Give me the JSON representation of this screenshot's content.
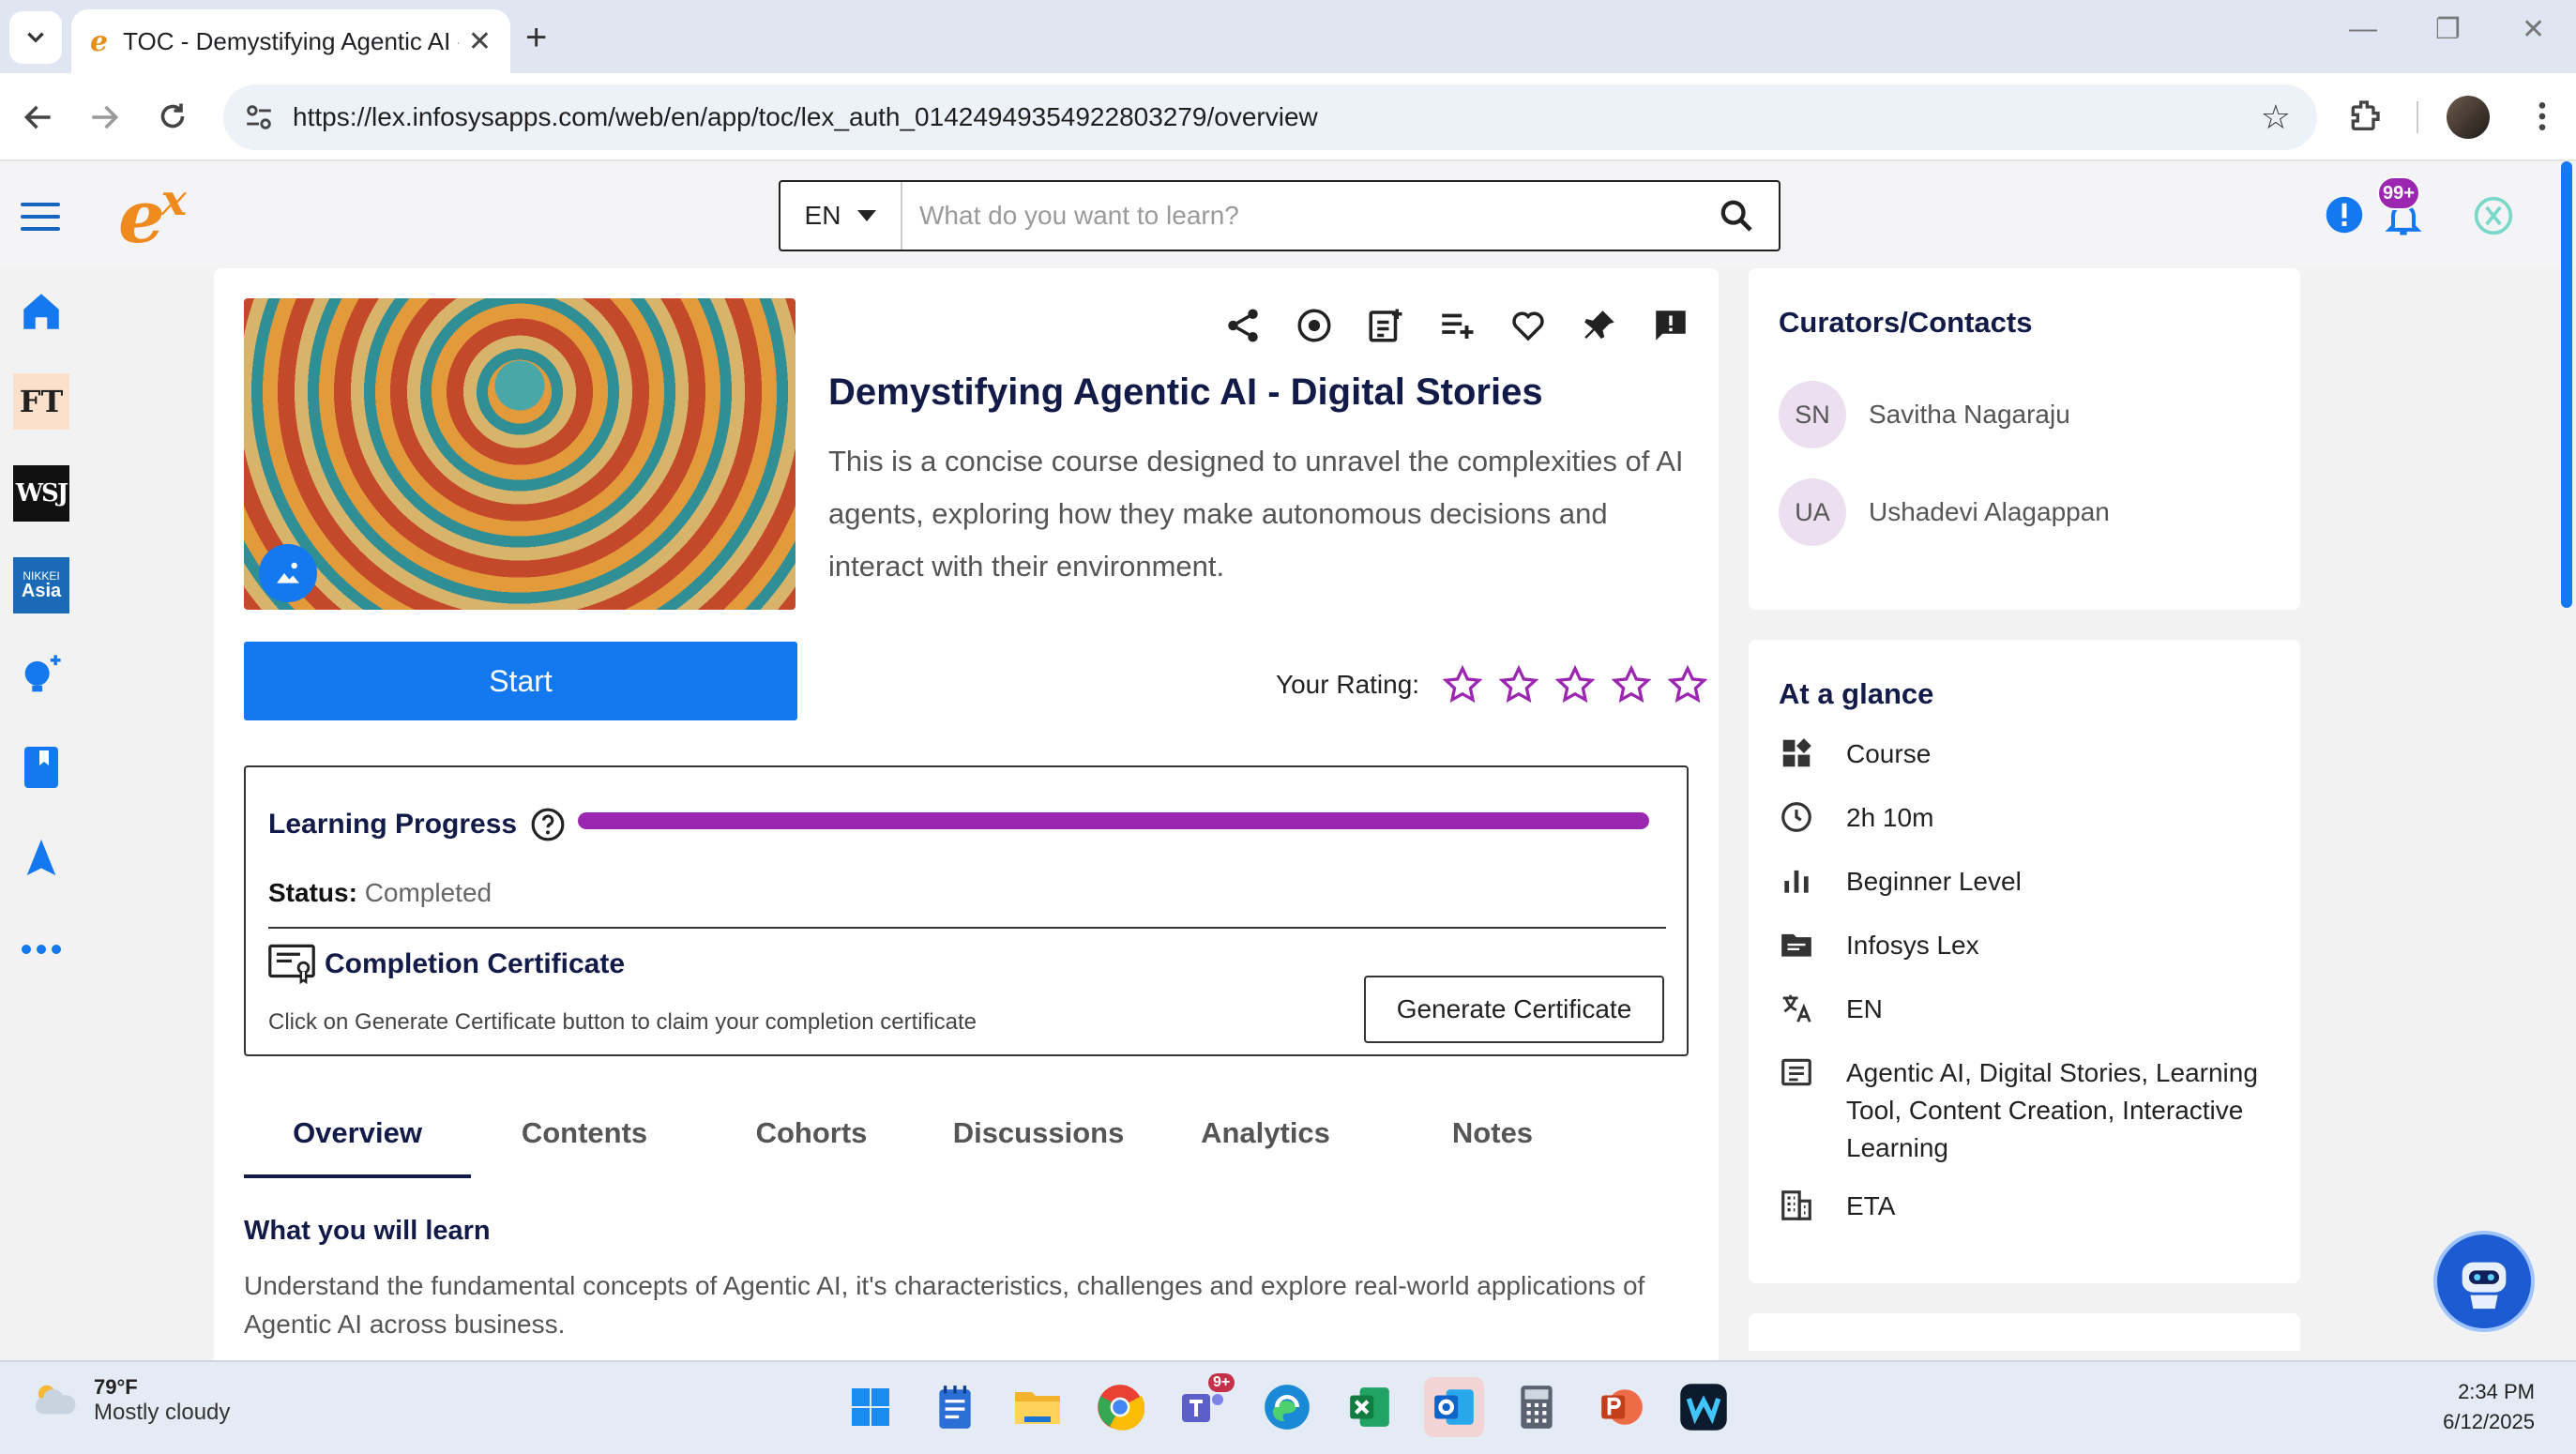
{
  "browser": {
    "tab_title": "TOC - Demystifying Agentic AI -",
    "url": "https://lex.infosysapps.com/web/en/app/toc/lex_auth_01424949354922803279/overview"
  },
  "header": {
    "language": "EN",
    "search_placeholder": "What do you want to learn?",
    "notification_count": "99+"
  },
  "course": {
    "title": "Demystifying Agentic AI - Digital Stories",
    "description": "This is a concise course designed to unravel the complexities of AI agents, exploring how they make autonomous decisions and interact with their environment.",
    "start_label": "Start",
    "rating_label": "Your Rating:",
    "rating_value": 0,
    "rating_max": 5
  },
  "progress": {
    "title": "Learning Progress",
    "status_label": "Status:",
    "status_value": "Completed",
    "percent": 100,
    "cert_title": "Completion Certificate",
    "cert_note": "Click on Generate Certificate button to claim your completion certificate",
    "cert_button": "Generate Certificate"
  },
  "tabs": [
    "Overview",
    "Contents",
    "Cohorts",
    "Discussions",
    "Analytics",
    "Notes"
  ],
  "active_tab": "Overview",
  "learn": {
    "heading": "What you will learn",
    "text": "Understand the fundamental concepts of Agentic AI, it's characteristics, challenges and explore real-world applications of Agentic AI across business."
  },
  "curators": {
    "heading": "Curators/Contacts",
    "people": [
      {
        "initials": "SN",
        "name": "Savitha Nagaraju"
      },
      {
        "initials": "UA",
        "name": "Ushadevi Alagappan"
      }
    ]
  },
  "glance": {
    "heading": "At a glance",
    "items": [
      {
        "icon": "widgets-icon",
        "value": "Course"
      },
      {
        "icon": "clock-icon",
        "value": "2h 10m"
      },
      {
        "icon": "bar-chart-icon",
        "value": "Beginner Level"
      },
      {
        "icon": "folder-icon",
        "value": "Infosys Lex"
      },
      {
        "icon": "translate-icon",
        "value": "EN"
      },
      {
        "icon": "tags-icon",
        "value": "Agentic AI, Digital Stories, Learning Tool, Content Creation, Interactive Learning"
      },
      {
        "icon": "building-icon",
        "value": "ETA"
      }
    ]
  },
  "rail": {
    "ft": "FT",
    "wsj": "WSJ",
    "nikkei_top": "NIKKEI",
    "nikkei_bottom": "Asia"
  },
  "taskbar": {
    "temperature": "79°F",
    "weather": "Mostly cloudy",
    "time": "2:34 PM",
    "date": "6/12/2025",
    "teams_badge": "9+"
  },
  "colors": {
    "accent_blue": "#1479f0",
    "progress_purple": "#9b27b0",
    "title_navy": "#121b48"
  }
}
